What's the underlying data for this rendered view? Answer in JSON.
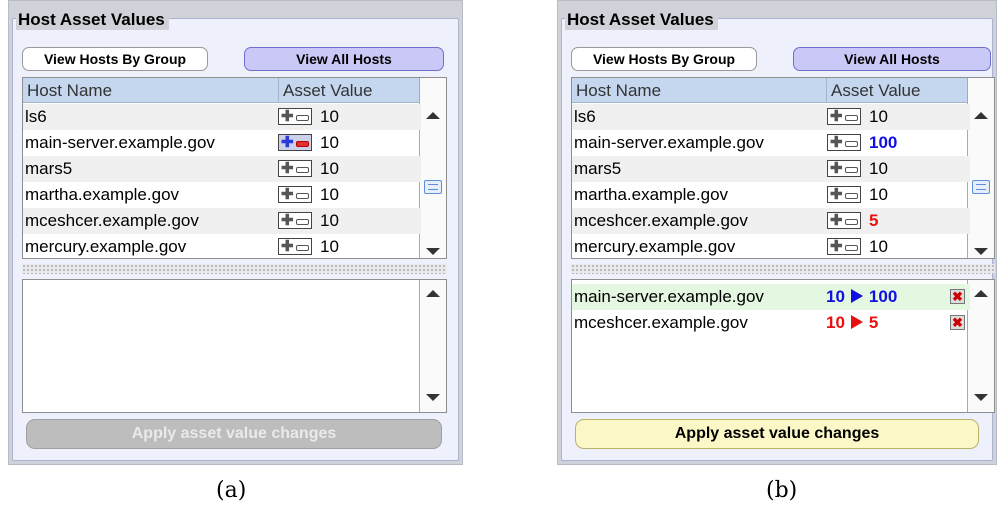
{
  "panel_title": "Host Asset Values",
  "buttons": {
    "by_group": "View Hosts By Group",
    "all_hosts": "View All Hosts",
    "apply": "Apply asset value changes"
  },
  "columns": {
    "host": "Host Name",
    "value": "Asset Value"
  },
  "panel_a": {
    "caption": "(a)",
    "rows": [
      {
        "name": "ls6",
        "value": "10"
      },
      {
        "name": "main-server.example.gov",
        "value": "10"
      },
      {
        "name": "mars5",
        "value": "10"
      },
      {
        "name": "martha.example.gov",
        "value": "10"
      },
      {
        "name": "mceshcer.example.gov",
        "value": "10"
      },
      {
        "name": "mercury.example.gov",
        "value": "10"
      }
    ]
  },
  "panel_b": {
    "caption": "(b)",
    "rows": [
      {
        "name": "ls6",
        "value": "10"
      },
      {
        "name": "main-server.example.gov",
        "value": "100"
      },
      {
        "name": "mars5",
        "value": "10"
      },
      {
        "name": "martha.example.gov",
        "value": "10"
      },
      {
        "name": "mceshcer.example.gov",
        "value": "5"
      },
      {
        "name": "mercury.example.gov",
        "value": "10"
      }
    ],
    "changes": [
      {
        "name": "main-server.example.gov",
        "from": "10",
        "to": "100"
      },
      {
        "name": "mceshcer.example.gov",
        "from": "10",
        "to": "5"
      }
    ]
  },
  "colors": {
    "increase": "#1010e0",
    "decrease": "#e81010",
    "highlight_row": "#e4f7e0"
  },
  "icons": {
    "plus_minus": "plus-minus-icon",
    "delete": "delete-x-icon"
  }
}
